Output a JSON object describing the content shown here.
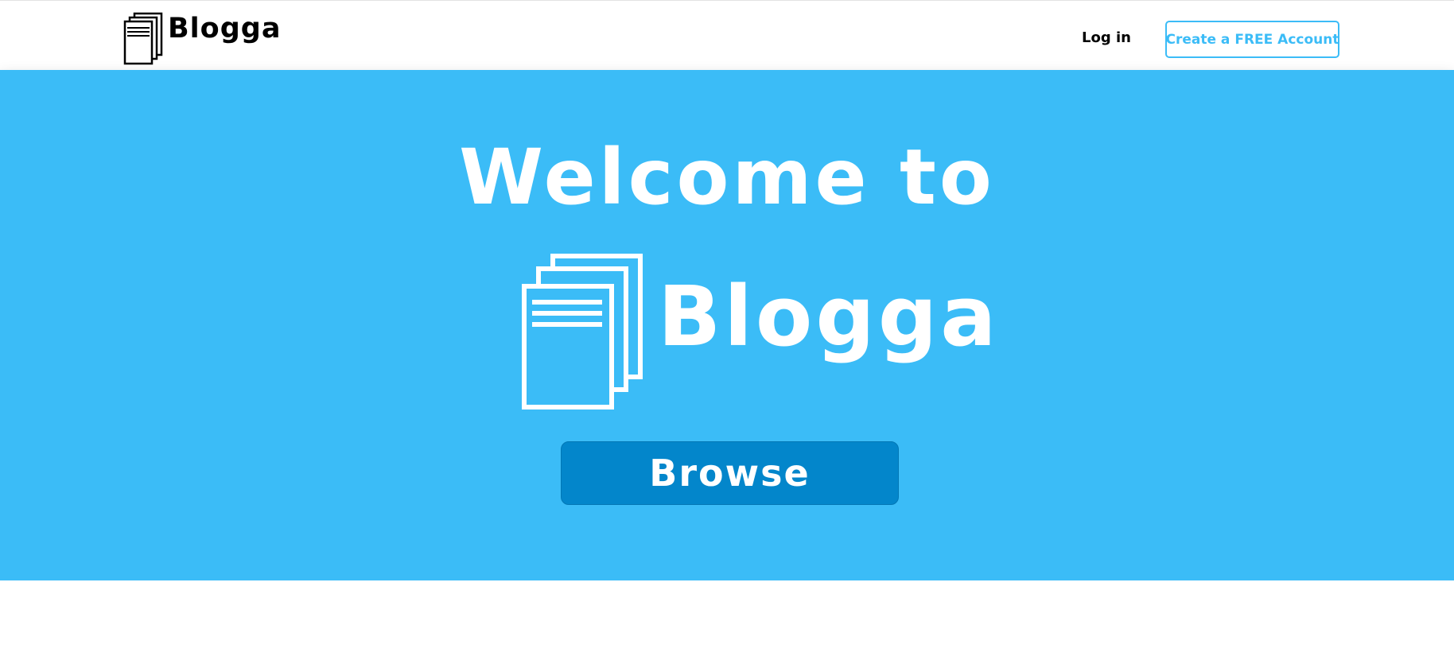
{
  "header": {
    "brand_name": "Blogga",
    "brand_icon": "stacked-documents-icon",
    "login_label": "Log in",
    "create_account_label": "Create a FREE Account"
  },
  "hero": {
    "welcome_text": "Welcome to",
    "brand_name": "Blogga",
    "brand_icon": "stacked-documents-icon",
    "browse_label": "Browse"
  },
  "colors": {
    "hero_background": "#3bbcf7",
    "accent": "#3bbcf7",
    "browse_button": "#0386cb",
    "header_background": "#ffffff",
    "brand_text": "#000000"
  }
}
